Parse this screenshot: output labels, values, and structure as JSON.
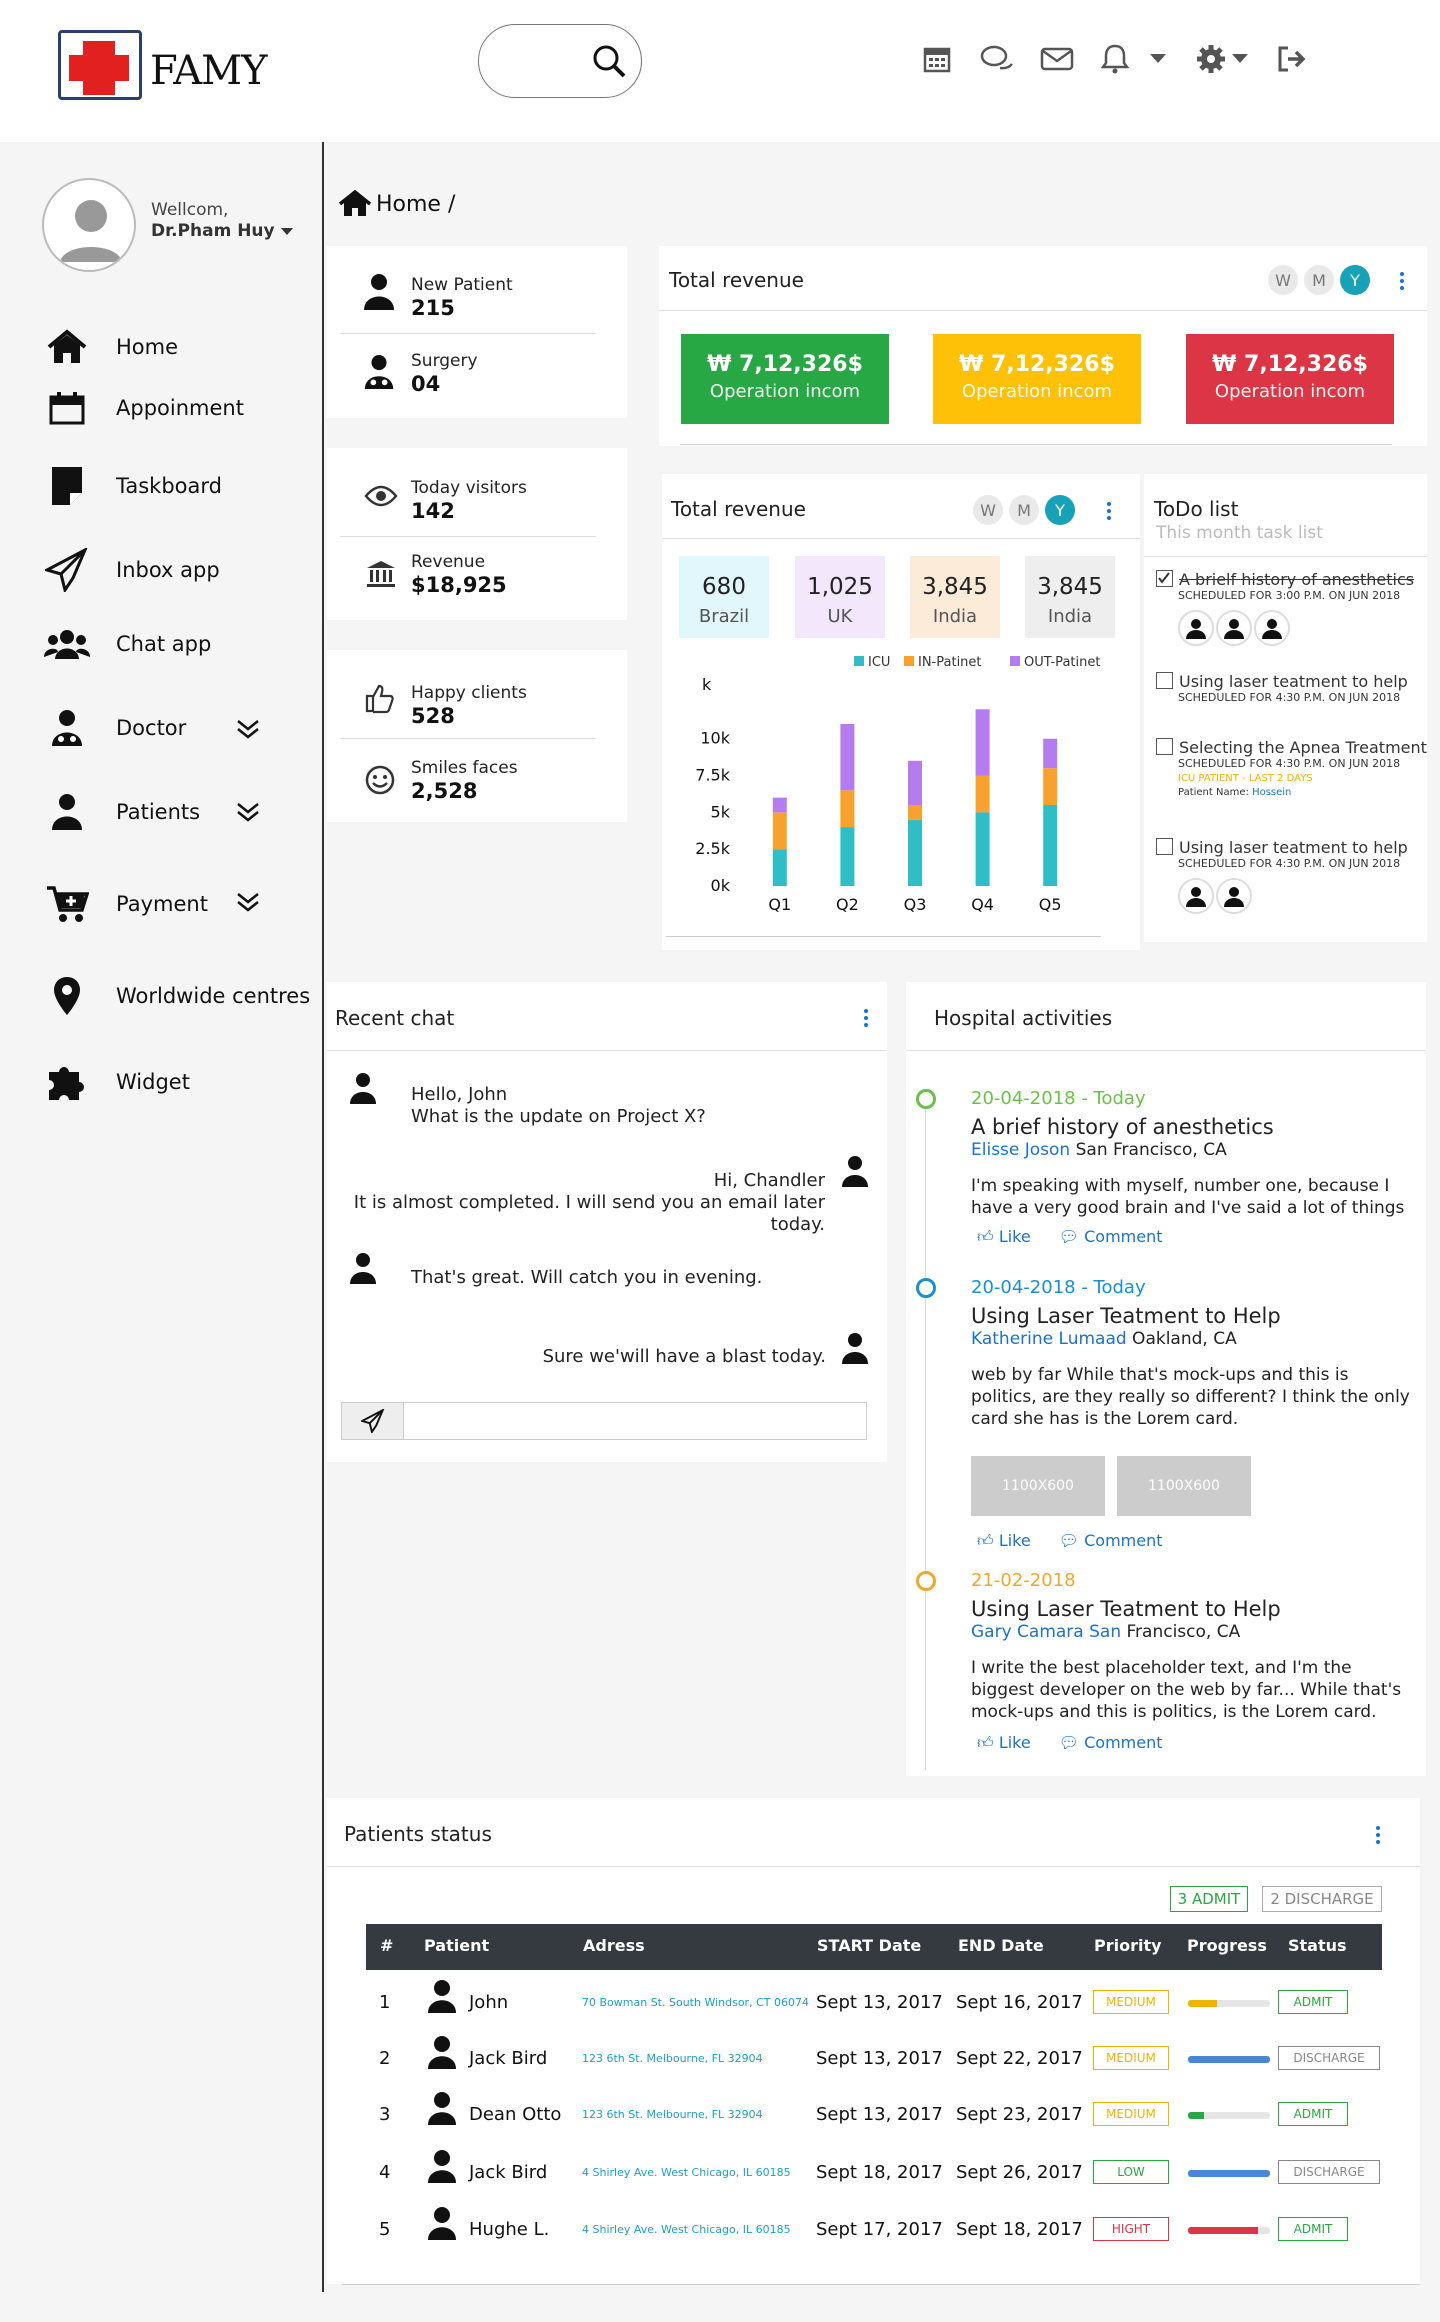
{
  "header": {
    "logo_text": "FAMY",
    "icons": [
      "calendar-icon",
      "chat-icon",
      "mail-icon",
      "bell-icon",
      "gear-icon",
      "logout-icon"
    ]
  },
  "sidebar": {
    "welcome": "Wellcom,",
    "user": "Dr.Pham Huy",
    "items": [
      {
        "label": "Home",
        "icon": "home-icon"
      },
      {
        "label": "Appoinment",
        "icon": "calendar-icon"
      },
      {
        "label": "Taskboard",
        "icon": "note-icon"
      },
      {
        "label": "Inbox app",
        "icon": "paper-plane-icon"
      },
      {
        "label": "Chat app",
        "icon": "users-icon"
      },
      {
        "label": "Doctor",
        "icon": "doctor-icon"
      },
      {
        "label": "Patients",
        "icon": "patient-icon"
      },
      {
        "label": "Payment",
        "icon": "cart-icon"
      },
      {
        "label": "Worldwide centres",
        "icon": "map-pin-icon"
      },
      {
        "label": "Widget",
        "icon": "puzzle-icon"
      }
    ]
  },
  "breadcrumb": {
    "label": "Home /"
  },
  "stats": [
    {
      "label": "New Patient",
      "value": "215"
    },
    {
      "label": "Surgery",
      "value": "04"
    },
    {
      "label": "Today visitors",
      "value": "142"
    },
    {
      "label": "Revenue",
      "value": "$18,925"
    },
    {
      "label": "Happy clients",
      "value": "528"
    },
    {
      "label": "Smiles faces",
      "value": "2,528"
    }
  ],
  "revenue1": {
    "title": "Total revenue",
    "toggles": [
      "W",
      "M",
      "Y"
    ],
    "boxes": [
      {
        "value": "7,12,326$",
        "label": "Operation incom",
        "color": "#28a745"
      },
      {
        "value": "7,12,326$",
        "label": "Operation incom",
        "color": "#ffc107"
      },
      {
        "value": "7,12,326$",
        "label": "Operation incom",
        "color": "#dc3545"
      }
    ]
  },
  "revenue2": {
    "title": "Total revenue",
    "toggles": [
      "W",
      "M",
      "Y"
    ],
    "kpis": [
      {
        "value": "680",
        "label": "Brazil",
        "color": "#e1f7fb"
      },
      {
        "value": "1,025",
        "label": "UK",
        "color": "#f3e8fb"
      },
      {
        "value": "3,845",
        "label": "India",
        "color": "#fdebd9"
      },
      {
        "value": "3,845",
        "label": "India",
        "color": "#eeeeee"
      }
    ]
  },
  "chart_data": {
    "type": "bar",
    "stacked": true,
    "categories": [
      "Q1",
      "Q2",
      "Q3",
      "Q4",
      "Q5"
    ],
    "series": [
      {
        "name": "ICU",
        "color": "#2fbdc6",
        "values": [
          2.5,
          4.0,
          4.5,
          5.0,
          5.5
        ]
      },
      {
        "name": "IN-Patinet",
        "color": "#f7a12f",
        "values": [
          2.5,
          2.5,
          1.0,
          2.5,
          2.5
        ]
      },
      {
        "name": "OUT-Patinet",
        "color": "#b57cf0",
        "values": [
          1.0,
          4.5,
          3.0,
          4.5,
          2.0
        ]
      }
    ],
    "yunit": "k",
    "yticks": [
      "0k",
      "2.5k",
      "5k",
      "7.5k",
      "10k"
    ],
    "ylim": [
      0,
      11
    ],
    "legend": "top"
  },
  "todo": {
    "title": "ToDo list",
    "subtitle": "This month task list",
    "items": [
      {
        "label": "A brielf history of anesthetics",
        "sched": "SCHEDULED FOR 3:00 P.M. ON JUN 2018",
        "done": true
      },
      {
        "label": "Using laser teatment to help",
        "sched": "SCHEDULED FOR 4:30 P.M. ON JUN 2018",
        "done": false
      },
      {
        "label": "Selecting the Apnea Treatment",
        "sched": "SCHEDULED FOR 4:30 P.M. ON JUN 2018",
        "extra": "ICU PATIENT - LAST 2 DAYS",
        "patient_label": "Patient Name:",
        "patient": "Hossein",
        "done": false
      },
      {
        "label": "Using laser teatment to help",
        "sched": "SCHEDULED FOR 4:30 P.M. ON JUN 2018",
        "done": false
      }
    ]
  },
  "chat": {
    "title": "Recent chat",
    "messages": [
      {
        "line1": "Hello, John",
        "line2": "What is the update on Project X?"
      },
      {
        "line1": "Hi, Chandler",
        "line2": "It is almost completed. I will send you an email later today."
      },
      {
        "line1": "That's great. Will catch you in evening."
      },
      {
        "line1": "Sure we'will have a blast today."
      }
    ],
    "input_placeholder": ""
  },
  "activities": {
    "title": "Hospital  activities",
    "items": [
      {
        "date": "20-04-2018 - Today",
        "title": "A brief history of anesthetics",
        "person": "Elisse Joson",
        "place": " San Francisco, CA",
        "body": "I'm speaking with myself, number one, because I have a very good brain and I've said a lot of things",
        "like": "Like",
        "comment": "Comment",
        "color": "#6cc04a"
      },
      {
        "date": "20-04-2018 - Today",
        "title": "Using Laser Teatment to Help",
        "person": "Katherine Lumaad",
        "place": " Oakland, CA",
        "body": "web by far While that's mock-ups and this is politics, are they really so different? I think the only card she has is the Lorem card.",
        "like": "Like",
        "comment": "Comment",
        "color": "#1a8fd1",
        "ph1": "1100X600",
        "ph2": "1100X600"
      },
      {
        "date": "21-02-2018",
        "title": "Using Laser Teatment to Help",
        "person": "Gary Camara San",
        "place": " Francisco, CA",
        "body": "I write the best placeholder text, and I'm the biggest developer on the web by far... While that's mock-ups and this is politics, is the Lorem card.",
        "like": "Like",
        "comment": "Comment",
        "color": "#f0a72e"
      }
    ]
  },
  "patients": {
    "title": "Patients status",
    "admit_badge": "3 ADMIT",
    "discharge_badge": "2 DISCHARGE",
    "columns": [
      "#",
      "Patient",
      "Adress",
      "START Date",
      "END Date",
      "Priority",
      "Progress",
      "Status"
    ],
    "rows": [
      {
        "n": "1",
        "name": "John",
        "addr": "70 Bowman St. South Windsor, CT 06074",
        "start": "Sept 13, 2017",
        "end": "Sept 16, 2017",
        "priority": "MEDIUM",
        "pcolor": "#f0b400",
        "progress": 0.35,
        "barcolor": "#f0b400",
        "status": "ADMIT",
        "scolor": "#28a745"
      },
      {
        "n": "2",
        "name": "Jack Bird",
        "addr": "123 6th St. Melbourne, FL 32904",
        "start": "Sept 13, 2017",
        "end": "Sept 22, 2017",
        "priority": "MEDIUM",
        "pcolor": "#f0b400",
        "progress": 1.0,
        "barcolor": "#4a86d8",
        "status": "DISCHARGE",
        "scolor": "#888888"
      },
      {
        "n": "3",
        "name": "Dean Otto",
        "addr": "123 6th St. Melbourne, FL 32904",
        "start": "Sept 13, 2017",
        "end": "Sept 23, 2017",
        "priority": "MEDIUM",
        "pcolor": "#f0b400",
        "progress": 0.2,
        "barcolor": "#28a745",
        "status": "ADMIT",
        "scolor": "#28a745"
      },
      {
        "n": "4",
        "name": "Jack Bird",
        "addr": "4 Shirley Ave. West Chicago, IL 60185",
        "start": "Sept 18, 2017",
        "end": "Sept 26, 2017",
        "priority": "LOW",
        "pcolor": "#28a745",
        "progress": 1.0,
        "barcolor": "#4a86d8",
        "status": "DISCHARGE",
        "scolor": "#888888"
      },
      {
        "n": "5",
        "name": "Hughe L.",
        "addr": "4 Shirley Ave. West Chicago, IL 60185",
        "start": "Sept 17, 2017",
        "end": "Sept 18, 2017",
        "priority": "HIGHT",
        "pcolor": "#dc3545",
        "progress": 0.85,
        "barcolor": "#dc3545",
        "status": "ADMIT",
        "scolor": "#28a745"
      }
    ]
  }
}
